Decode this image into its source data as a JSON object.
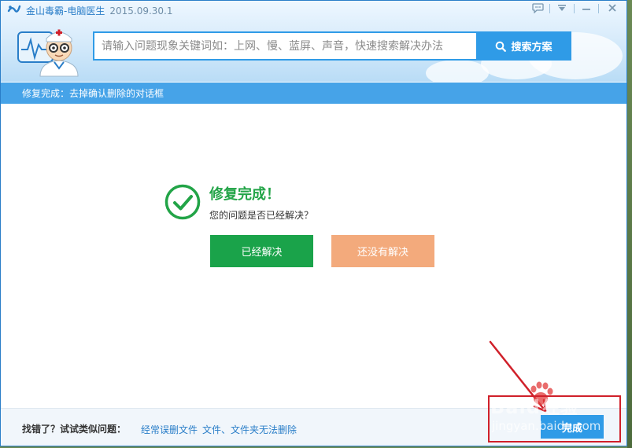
{
  "app": {
    "title": "金山毒霸-电脑医生",
    "version": "2015.09.30.1"
  },
  "search": {
    "placeholder": "请输入问题现象关键词如：上网、慢、蓝屏、声音，快速搜索解决办法",
    "button_label": "搜索方案"
  },
  "status_bar": {
    "text": "修复完成：去掉确认删除的对话框"
  },
  "result": {
    "title": "修复完成！",
    "question": "您的问题是否已经解决？",
    "solved_label": "已经解决",
    "unsolved_label": "还没有解决"
  },
  "footer": {
    "label": "找错了？试试类似问题：",
    "links": [
      "经常误删文件",
      "文件、文件夹无法删除"
    ],
    "done_label": "完成"
  },
  "watermark": {
    "brand": "Baid",
    "brand_cn": "经验",
    "url": "jingyan.baidu.com"
  },
  "colors": {
    "accent_blue": "#2f9be7",
    "success_green": "#1aa34a",
    "unsolved_orange": "#f3aa7c",
    "highlight_red": "#d0202a"
  },
  "icons": {
    "app_logo": "kingsoft-logo-icon",
    "search": "search-icon",
    "chat": "chat-icon",
    "menu": "menu-icon",
    "minimize": "minimize-icon",
    "close": "close-icon",
    "success": "checkmark-circle-icon"
  }
}
